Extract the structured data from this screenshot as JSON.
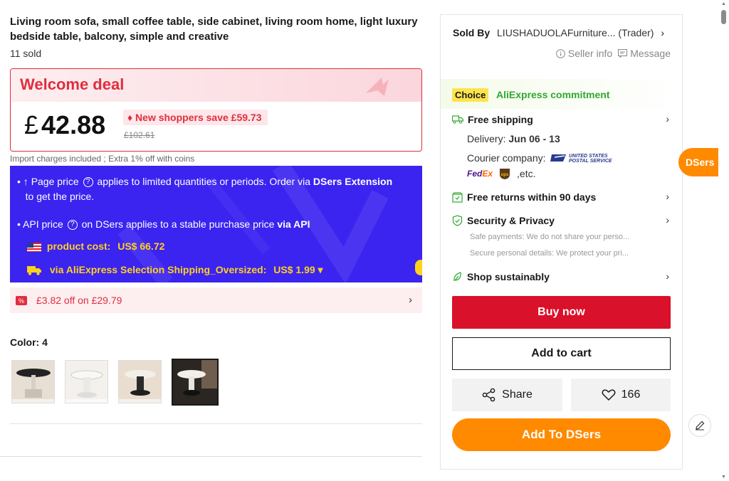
{
  "product": {
    "title": "Living room sofa, small coffee table, side cabinet, living room home, light luxury bedside table, balcony, simple and creative",
    "sold": "11 sold"
  },
  "deal": {
    "title": "Welcome deal",
    "currency": "£",
    "price": "42.88",
    "save_label": "New shoppers save",
    "save_amount": "£59.73",
    "original_price": "£102.61"
  },
  "import_note": "Import charges included ; Extra 1% off with coins",
  "dsers": {
    "line1_a": "Page price",
    "line1_b": "applies to limited quantities or periods. Order via",
    "line1_c": "DSers Extension",
    "line1_d": "to get the price.",
    "line2_a": "API price",
    "line2_b": "on DSers applies to a stable purchase price",
    "line2_c": "via API",
    "product_cost_label": "product cost:",
    "product_cost_value": "US$ 66.72",
    "shipping_label": "via AliExpress Selection Shipping_Oversized:",
    "shipping_value": "US$ 1.99"
  },
  "coupon": {
    "text": "£3.82 off on £29.79"
  },
  "color": {
    "label": "Color: 4",
    "thumbnails": [
      "variant-1",
      "variant-2",
      "variant-3",
      "variant-4"
    ],
    "selected": 3
  },
  "seller": {
    "sold_by_label": "Sold By",
    "name": "LIUSHADUOLAFurniture... (Trader)",
    "info_label": "Seller info",
    "message_label": "Message"
  },
  "commitment": {
    "choice_label": "Choice",
    "text": "AliExpress commitment"
  },
  "services": {
    "shipping_title": "Free shipping",
    "delivery_label": "Delivery:",
    "delivery_value": "Jun 06 - 13",
    "courier_label": "Courier company:",
    "usps_text": "UNITED STATES POSTAL SERVICE",
    "fedex_text": "FedEx",
    "ups_text": "ups",
    "etc": ",etc.",
    "returns_title": "Free returns within 90 days",
    "security_title": "Security & Privacy",
    "security_line1": "Safe payments: We do not share your perso...",
    "security_line2": "Secure personal details: We protect your pri...",
    "sustain_title": "Shop sustainably"
  },
  "actions": {
    "buy_now": "Buy now",
    "add_to_cart": "Add to cart",
    "share": "Share",
    "wishlist_count": "166",
    "add_to_dsers": "Add To DSers"
  },
  "side": {
    "dsers_tab": "DSers"
  },
  "colors": {
    "accent_red": "#d9112a",
    "dsers_blue": "#3b23f0",
    "dsers_orange": "#ff8a00",
    "choice_yellow": "#ffe34d",
    "commit_green": "#2fa82f"
  }
}
